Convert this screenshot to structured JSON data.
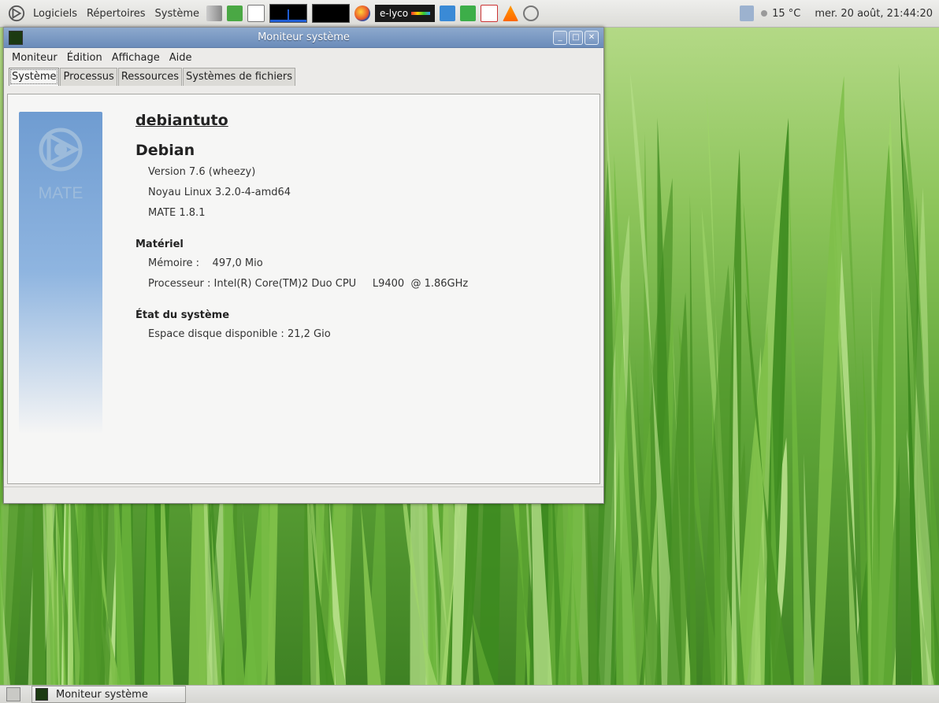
{
  "top_panel": {
    "menus": [
      "Logiciels",
      "Répertoires",
      "Système"
    ],
    "launcher": "e-lyco",
    "weather": "15 °C",
    "clock": "mer. 20 août, 21:44:20"
  },
  "window": {
    "title": "Moniteur système",
    "menubar": [
      "Moniteur",
      "Édition",
      "Affichage",
      "Aide"
    ],
    "tabs": [
      "Système",
      "Processus",
      "Ressources",
      "Systèmes de fichiers"
    ],
    "active_tab": "Système"
  },
  "system": {
    "logo_text": "MATE",
    "hostname": "debiantuto",
    "distro": "Debian",
    "version": "Version 7.6 (wheezy)",
    "kernel": "Noyau Linux 3.2.0-4-amd64",
    "desktop": "MATE 1.8.1",
    "hardware_title": "Matériel",
    "memory": "Mémoire :    497,0 Mio",
    "processor": "Processeur : Intel(R) Core(TM)2 Duo CPU     L9400  @ 1.86GHz",
    "status_title": "État du système",
    "disk": "Espace disque disponible : 21,2 Gio"
  },
  "taskbar": {
    "item": "Moniteur système"
  },
  "colors": {
    "title_bar": "#7594c0",
    "sidebar_blue": "#6f9cd1",
    "wallpaper_green": "#5fa538"
  },
  "icons": {
    "menu_logo": "mate-logo-icon",
    "volume": "volume-icon",
    "exit": "logout-icon",
    "firefox": "firefox-icon",
    "vlc": "vlc-icon"
  }
}
